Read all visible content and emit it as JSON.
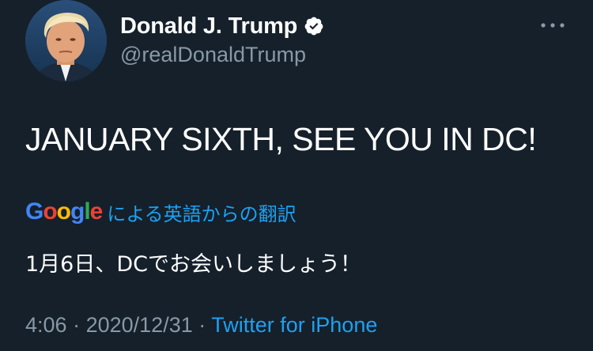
{
  "author": {
    "display_name": "Donald J. Trump",
    "handle": "@realDonaldTrump",
    "verified": true,
    "avatar_icon": "profile-photo"
  },
  "tweet": {
    "text": "JANUARY SIXTH, SEE YOU IN DC!"
  },
  "translation": {
    "provider_logo": [
      "G",
      "o",
      "o",
      "g",
      "l",
      "e"
    ],
    "label": "による英語からの翻訳",
    "text": "1月6日、DCでお会いしましょう！"
  },
  "meta": {
    "time": "4:06",
    "separator": "·",
    "date": "2020/12/31",
    "source": "Twitter for iPhone"
  },
  "colors": {
    "background": "#15202b",
    "secondary_text": "#8899a6",
    "link": "#1da1f2"
  }
}
